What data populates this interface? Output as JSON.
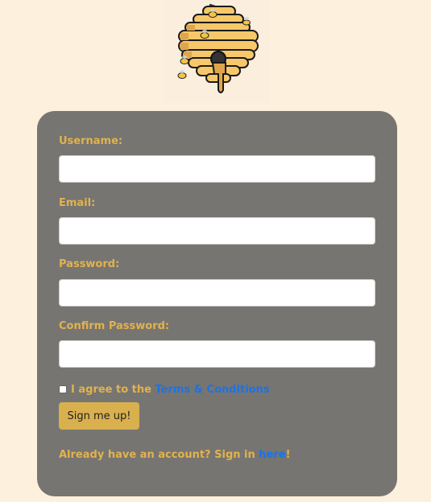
{
  "logo": {
    "icon": "beehive-icon"
  },
  "form": {
    "username_label": "Username:",
    "email_label": "Email:",
    "password_label": "Password:",
    "confirm_password_label": "Confirm Password:",
    "username_value": "",
    "email_value": "",
    "password_value": "",
    "confirm_password_value": "",
    "terms_prefix": "I agree to the ",
    "terms_link": "Terms & Conditions",
    "submit_label": "Sign me up!",
    "signin_prefix": "Already have an account? Sign in ",
    "signin_link": "here",
    "signin_suffix": "!"
  },
  "colors": {
    "page_background": "#fdf0dc",
    "card_background": "#767571",
    "label_gold": "#e2b24e",
    "button_gold": "#d9b04e",
    "link_blue": "#1a73e8"
  }
}
